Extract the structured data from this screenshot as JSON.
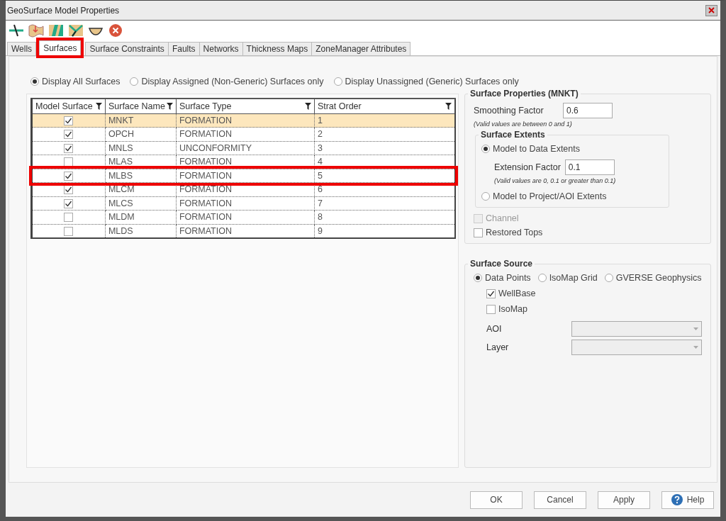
{
  "window": {
    "title": "GeoSurface Model Properties"
  },
  "toolbar": [
    {
      "kind": "fault"
    },
    {
      "kind": "surface"
    },
    {
      "kind": "faultblock"
    },
    {
      "kind": "intersect"
    },
    {
      "kind": "bowl"
    },
    {
      "kind": "delete"
    }
  ],
  "tabs": [
    {
      "label": "Wells",
      "selected": false,
      "highlighted": false
    },
    {
      "label": "Surfaces",
      "selected": true,
      "highlighted": true
    },
    {
      "label": "Surface Constraints",
      "selected": false,
      "highlighted": false
    },
    {
      "label": "Faults",
      "selected": false,
      "highlighted": false
    },
    {
      "label": "Networks",
      "selected": false,
      "highlighted": false
    },
    {
      "label": "Thickness Maps",
      "selected": false,
      "highlighted": false
    },
    {
      "label": "ZoneManager Attributes",
      "selected": false,
      "highlighted": false
    }
  ],
  "display_options": [
    {
      "label": "Display All Surfaces",
      "selected": true
    },
    {
      "label": "Display Assigned (Non-Generic) Surfaces only",
      "selected": false
    },
    {
      "label": "Display Unassigned (Generic) Surfaces only",
      "selected": false
    }
  ],
  "table": {
    "columns": [
      "Model Surface",
      "Surface Name",
      "Surface Type",
      "Strat Order"
    ],
    "rows": [
      {
        "checked": true,
        "name": "MNKT",
        "type": "FORMATION",
        "order": "1",
        "selected": true,
        "highlighted": false
      },
      {
        "checked": true,
        "name": "OPCH",
        "type": "FORMATION",
        "order": "2",
        "selected": false,
        "highlighted": false
      },
      {
        "checked": true,
        "name": "MNLS",
        "type": "UNCONFORMITY",
        "order": "3",
        "selected": false,
        "highlighted": false
      },
      {
        "checked": false,
        "name": "MLAS",
        "type": "FORMATION",
        "order": "4",
        "selected": false,
        "highlighted": false
      },
      {
        "checked": true,
        "name": "MLBS",
        "type": "FORMATION",
        "order": "5",
        "selected": false,
        "highlighted": true
      },
      {
        "checked": true,
        "name": "MLCM",
        "type": "FORMATION",
        "order": "6",
        "selected": false,
        "highlighted": false
      },
      {
        "checked": true,
        "name": "MLCS",
        "type": "FORMATION",
        "order": "7",
        "selected": false,
        "highlighted": false
      },
      {
        "checked": false,
        "name": "MLDM",
        "type": "FORMATION",
        "order": "8",
        "selected": false,
        "highlighted": false
      },
      {
        "checked": false,
        "name": "MLDS",
        "type": "FORMATION",
        "order": "9",
        "selected": false,
        "highlighted": false
      }
    ]
  },
  "surface_properties": {
    "title": "Surface Properties (MNKT)",
    "smoothing_label": "Smoothing Factor",
    "smoothing_value": "0.6",
    "smoothing_hint": "(Valid values are between 0 and 1)",
    "extents": {
      "title": "Surface Extents",
      "options": [
        {
          "label": "Model to Data Extents",
          "selected": true
        },
        {
          "label": "Model to Project/AOI Extents",
          "selected": false
        }
      ],
      "extension_label": "Extension Factor",
      "extension_value": "0.1",
      "extension_hint": "(Valid values are 0, 0.1 or greater than 0.1)"
    },
    "checks": [
      {
        "label": "Channel",
        "checked": false,
        "disabled": true
      },
      {
        "label": "Restored Tops",
        "checked": false,
        "disabled": false
      }
    ]
  },
  "surface_source": {
    "title": "Surface Source",
    "options": [
      {
        "label": "Data Points",
        "selected": true
      },
      {
        "label": "IsoMap Grid",
        "selected": false
      },
      {
        "label": "GVERSE Geophysics",
        "selected": false
      }
    ],
    "checks": [
      {
        "label": "WellBase",
        "checked": true
      },
      {
        "label": "IsoMap",
        "checked": false
      }
    ],
    "dropdowns": [
      {
        "label": "AOI"
      },
      {
        "label": "Layer"
      }
    ]
  },
  "buttons": [
    {
      "label": "OK",
      "kind": "plain"
    },
    {
      "label": "Cancel",
      "kind": "plain"
    },
    {
      "label": "Apply",
      "kind": "plain"
    },
    {
      "label": "Help",
      "kind": "help"
    }
  ]
}
